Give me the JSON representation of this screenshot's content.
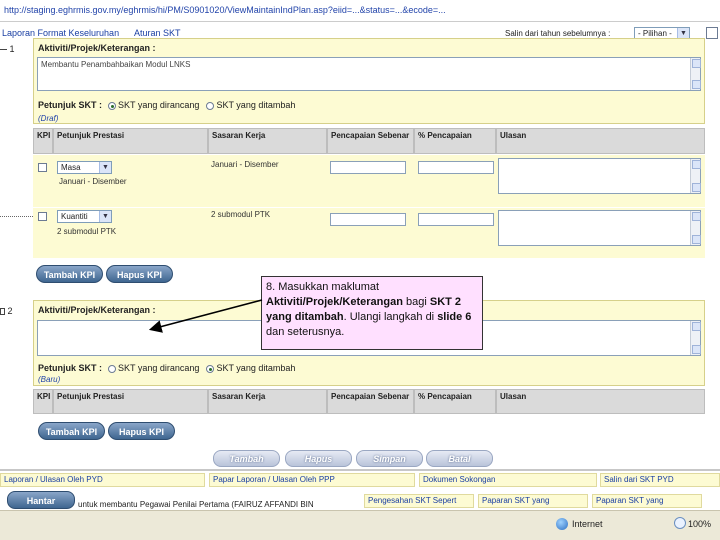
{
  "url": "http://staging.eghrmis.gov.my/eghrmis/hi/PM/S0901020/ViewMaintainIndPlan.asp?eiid=...&status=...&ecode=...",
  "top": {
    "link1": "Laporan Format Keseluruhan",
    "link2": "Aturan SKT",
    "year_label": "Salin dari tahun sebelumnya :",
    "year_select": "- Pilihan -"
  },
  "skt1": {
    "num": "1",
    "header": "Aktiviti/Projek/Keterangan :",
    "text": "Membantu Penambahbaikan Modul LNKS",
    "petunjuk_label": "Petunjuk SKT :",
    "opt1": "SKT yang dirancang",
    "opt2": "SKT yang ditambah",
    "status": "(Draf)"
  },
  "table_headers": {
    "kpi": "KPI",
    "petunjuk": "Petunjuk Prestasi",
    "sasaran": "Sasaran Kerja",
    "pencapaian": "Pencapaian Sebenar",
    "peratus": "% Pencapaian",
    "ulasan": "Ulasan"
  },
  "rows": [
    {
      "select": "Masa",
      "detail": "Januari - Disember",
      "sasaran": "Januari - Disember"
    },
    {
      "select": "Kuantiti",
      "detail": "2 submodul PTK",
      "sasaran": "2 submodul PTK"
    }
  ],
  "buttons": {
    "tambah_kpi": "Tambah KPI",
    "hapus_kpi": "Hapus KPI",
    "tambah": "Tambah",
    "hapus": "Hapus",
    "simpan": "Simpan",
    "batal": "Batal",
    "hantar": "Hantar"
  },
  "skt2": {
    "num": "2",
    "header": "Aktiviti/Projek/Keterangan :",
    "text": "",
    "petunjuk_label": "Petunjuk SKT :",
    "opt1": "SKT yang dirancang",
    "opt2": "SKT yang ditambah",
    "status": "(Baru)"
  },
  "callout": {
    "text1": "8. Masukkan maklumat ",
    "bold1": "Aktiviti/Projek/Keterangan",
    "text2": " bagi ",
    "bold2": "SKT 2 yang ditambah",
    "text3": ". Ulangi langkah di ",
    "bold3": "slide 6",
    "text4": " dan seterusnya."
  },
  "footer": {
    "f1": "Laporan / Ulasan Oleh PYD",
    "f2": "Papar Laporan / Ulasan Oleh PPP",
    "f3": "Dokumen Sokongan",
    "f4": "Salin dari SKT PYD",
    "f5": "untuk membantu Pegawai Penilai Pertama (FAIRUZ AFFANDI BIN",
    "f6": "Pengesahan SKT Sepert",
    "f7": "Paparan SKT yang",
    "f8": "Paparan SKT yang"
  },
  "status": {
    "zone": "Internet",
    "zoom": "100%"
  }
}
